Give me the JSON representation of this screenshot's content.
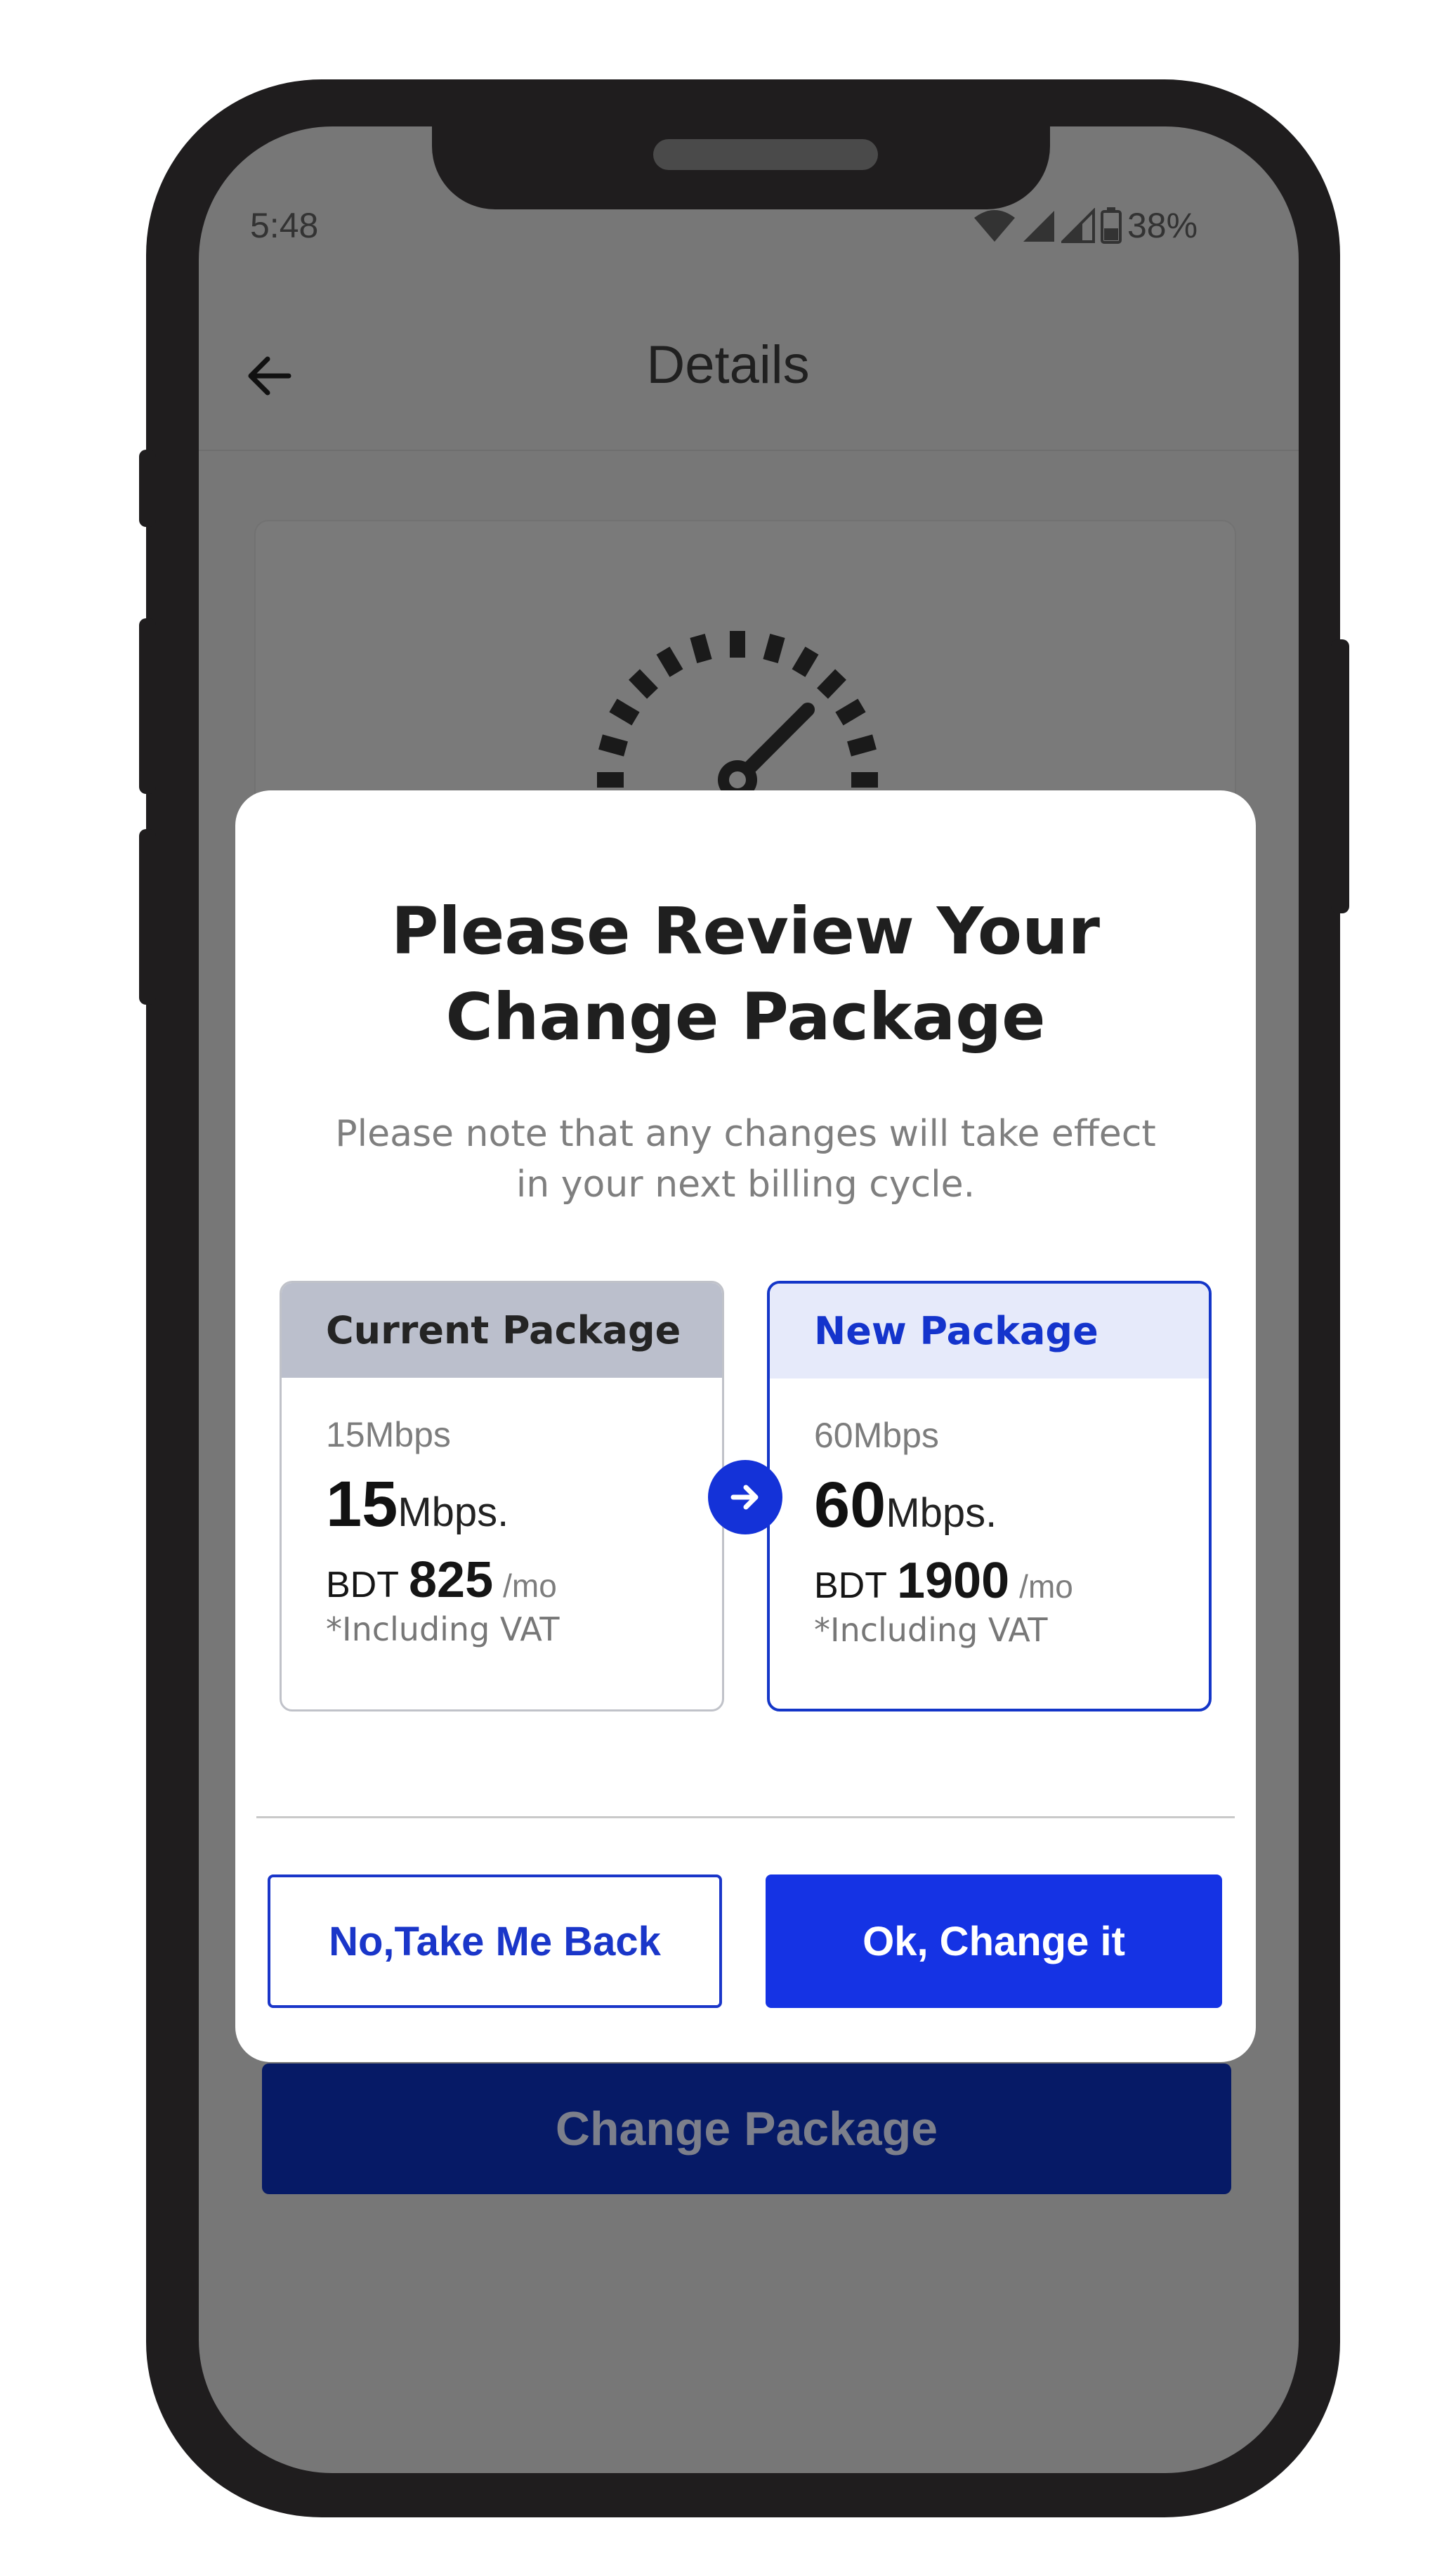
{
  "status_bar": {
    "time": "5:48",
    "battery_percent": "38%",
    "icons": [
      "wifi-icon",
      "signal-icon",
      "signal-icon",
      "battery-icon"
    ]
  },
  "app_header": {
    "title": "Details",
    "back_icon": "arrow-left-icon"
  },
  "background": {
    "change_package_label": "Change Package",
    "gauge_icon": "speedometer-icon"
  },
  "modal": {
    "title_line1": "Please Review Your",
    "title_line2": "Change Package",
    "note_line1": "Please note that any changes will take effect",
    "note_line2": "in your next billing cycle.",
    "current_package": {
      "header": "Current Package",
      "speed_name": "15Mbps",
      "speed_value": "15",
      "speed_unit": "Mbps.",
      "currency": "BDT",
      "price": "825",
      "period": "/mo",
      "vat_note": "*Including VAT"
    },
    "new_package": {
      "header": "New Package",
      "speed_name": "60Mbps",
      "speed_value": "60",
      "speed_unit": "Mbps.",
      "currency": "BDT",
      "price": "1900",
      "period": "/mo",
      "vat_note": "*Including VAT"
    },
    "arrow_icon": "arrow-right-icon",
    "back_button_label": "No,Take Me Back",
    "ok_button_label": "Ok, Change it"
  },
  "colors": {
    "accent_blue": "#1533e4",
    "dark_blue": "#061a66",
    "current_header_bg": "#bbbfcc",
    "new_header_bg": "#e6eafa",
    "overlay_gray": "#777777"
  }
}
